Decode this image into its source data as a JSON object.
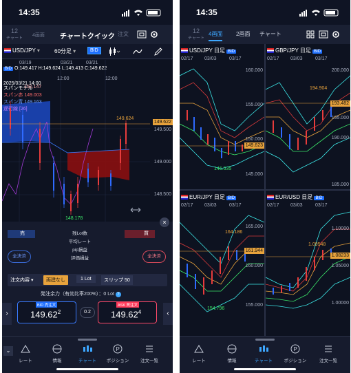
{
  "left": {
    "status_time": "14:35",
    "header": {
      "back_tab": "12",
      "back_tab_sub": "チャート",
      "tab_2": "4画面",
      "title": "チャートクイック",
      "order_tab": "注文"
    },
    "toolbar": {
      "pair": "USD/JPY",
      "interval": "60分足",
      "bid_label": "BID"
    },
    "ohlc": {
      "bid": "BID",
      "text": "O:149.417 H:149.624 L:149.413 C:149.622"
    },
    "dates": [
      "03/19",
      "03/21",
      "03/21"
    ],
    "times": [
      "12:00",
      "12:00"
    ],
    "crosshair_date": "2025/03/21 14:00",
    "indicator": {
      "title": "スパンモデル",
      "rows": [
        {
          "label": "スパン赤",
          "value": "149.003"
        },
        {
          "label": "スパン青",
          "value": "149.163"
        },
        {
          "label": "遅行線",
          "value": "[26]"
        }
      ],
      "top_value": "150.147"
    },
    "axis": [
      "149.500",
      "149.000",
      "148.500"
    ],
    "last_price": "149.622",
    "high_label": "149.624",
    "low_label": "148.178",
    "trade": {
      "sell": "売",
      "buy": "買",
      "rows": [
        "残Lot数",
        "平均レート",
        "pip損益",
        "評価損益"
      ],
      "close_all": "全決済",
      "order_type": "注文内容",
      "exec_type": "両建なし",
      "lot": "1 Lot",
      "slip": "スリップ 50",
      "margin_text": "発注余力（有効比率200%）：0 Lot",
      "bid_tag": "BID",
      "bid_order": "売注文",
      "bid_price_main": "149.62",
      "bid_price_sup": "2",
      "spread": "0.2",
      "ask_tag": "ASK",
      "ask_order": "買注文",
      "ask_price_main": "149.62",
      "ask_price_sup": "4"
    },
    "tabs": [
      "レート",
      "情報",
      "チャート",
      "ポジション",
      "注文一覧"
    ]
  },
  "right": {
    "status_time": "14:35",
    "header": {
      "back_tab": "12",
      "back_tab_sub": "チャート",
      "tab_4": "4画面",
      "tab_2": "2画面",
      "chart_tab": "チャート"
    },
    "quads": [
      {
        "pair": "USD/JPY",
        "interval": "日足",
        "bid": "BID",
        "dates": [
          "02/17",
          "03/03",
          "03/17"
        ],
        "axis": [
          "160.000",
          "155.000",
          "150.000",
          "145.000"
        ],
        "last": "149.623",
        "low": "146.535",
        "high": ""
      },
      {
        "pair": "GBP/JPY",
        "interval": "日足",
        "bid": "BID",
        "dates": [
          "02/17",
          "03/03",
          "03/17"
        ],
        "axis": [
          "200.000",
          "195.000",
          "190.000",
          "185.000"
        ],
        "last": "193.482",
        "low": "",
        "high": "194.904"
      },
      {
        "pair": "EUR/JPY",
        "interval": "日足",
        "bid": "BID",
        "dates": [
          "02/17",
          "03/03",
          "03/17"
        ],
        "axis": [
          "165.000",
          "160.000",
          "155.000"
        ],
        "last": "161.944",
        "low": "154.796",
        "high": "164.186"
      },
      {
        "pair": "EUR/USD",
        "interval": "日足",
        "bid": "BID",
        "dates": [
          "02/17",
          "03/03",
          "03/17"
        ],
        "axis": [
          "1.10000",
          "1.05000",
          "1.00000"
        ],
        "last": "1.08233",
        "low": "",
        "high": "1.09548"
      }
    ],
    "tabs": [
      "レート",
      "情報",
      "チャート",
      "ポジション",
      "注文一覧"
    ]
  }
}
